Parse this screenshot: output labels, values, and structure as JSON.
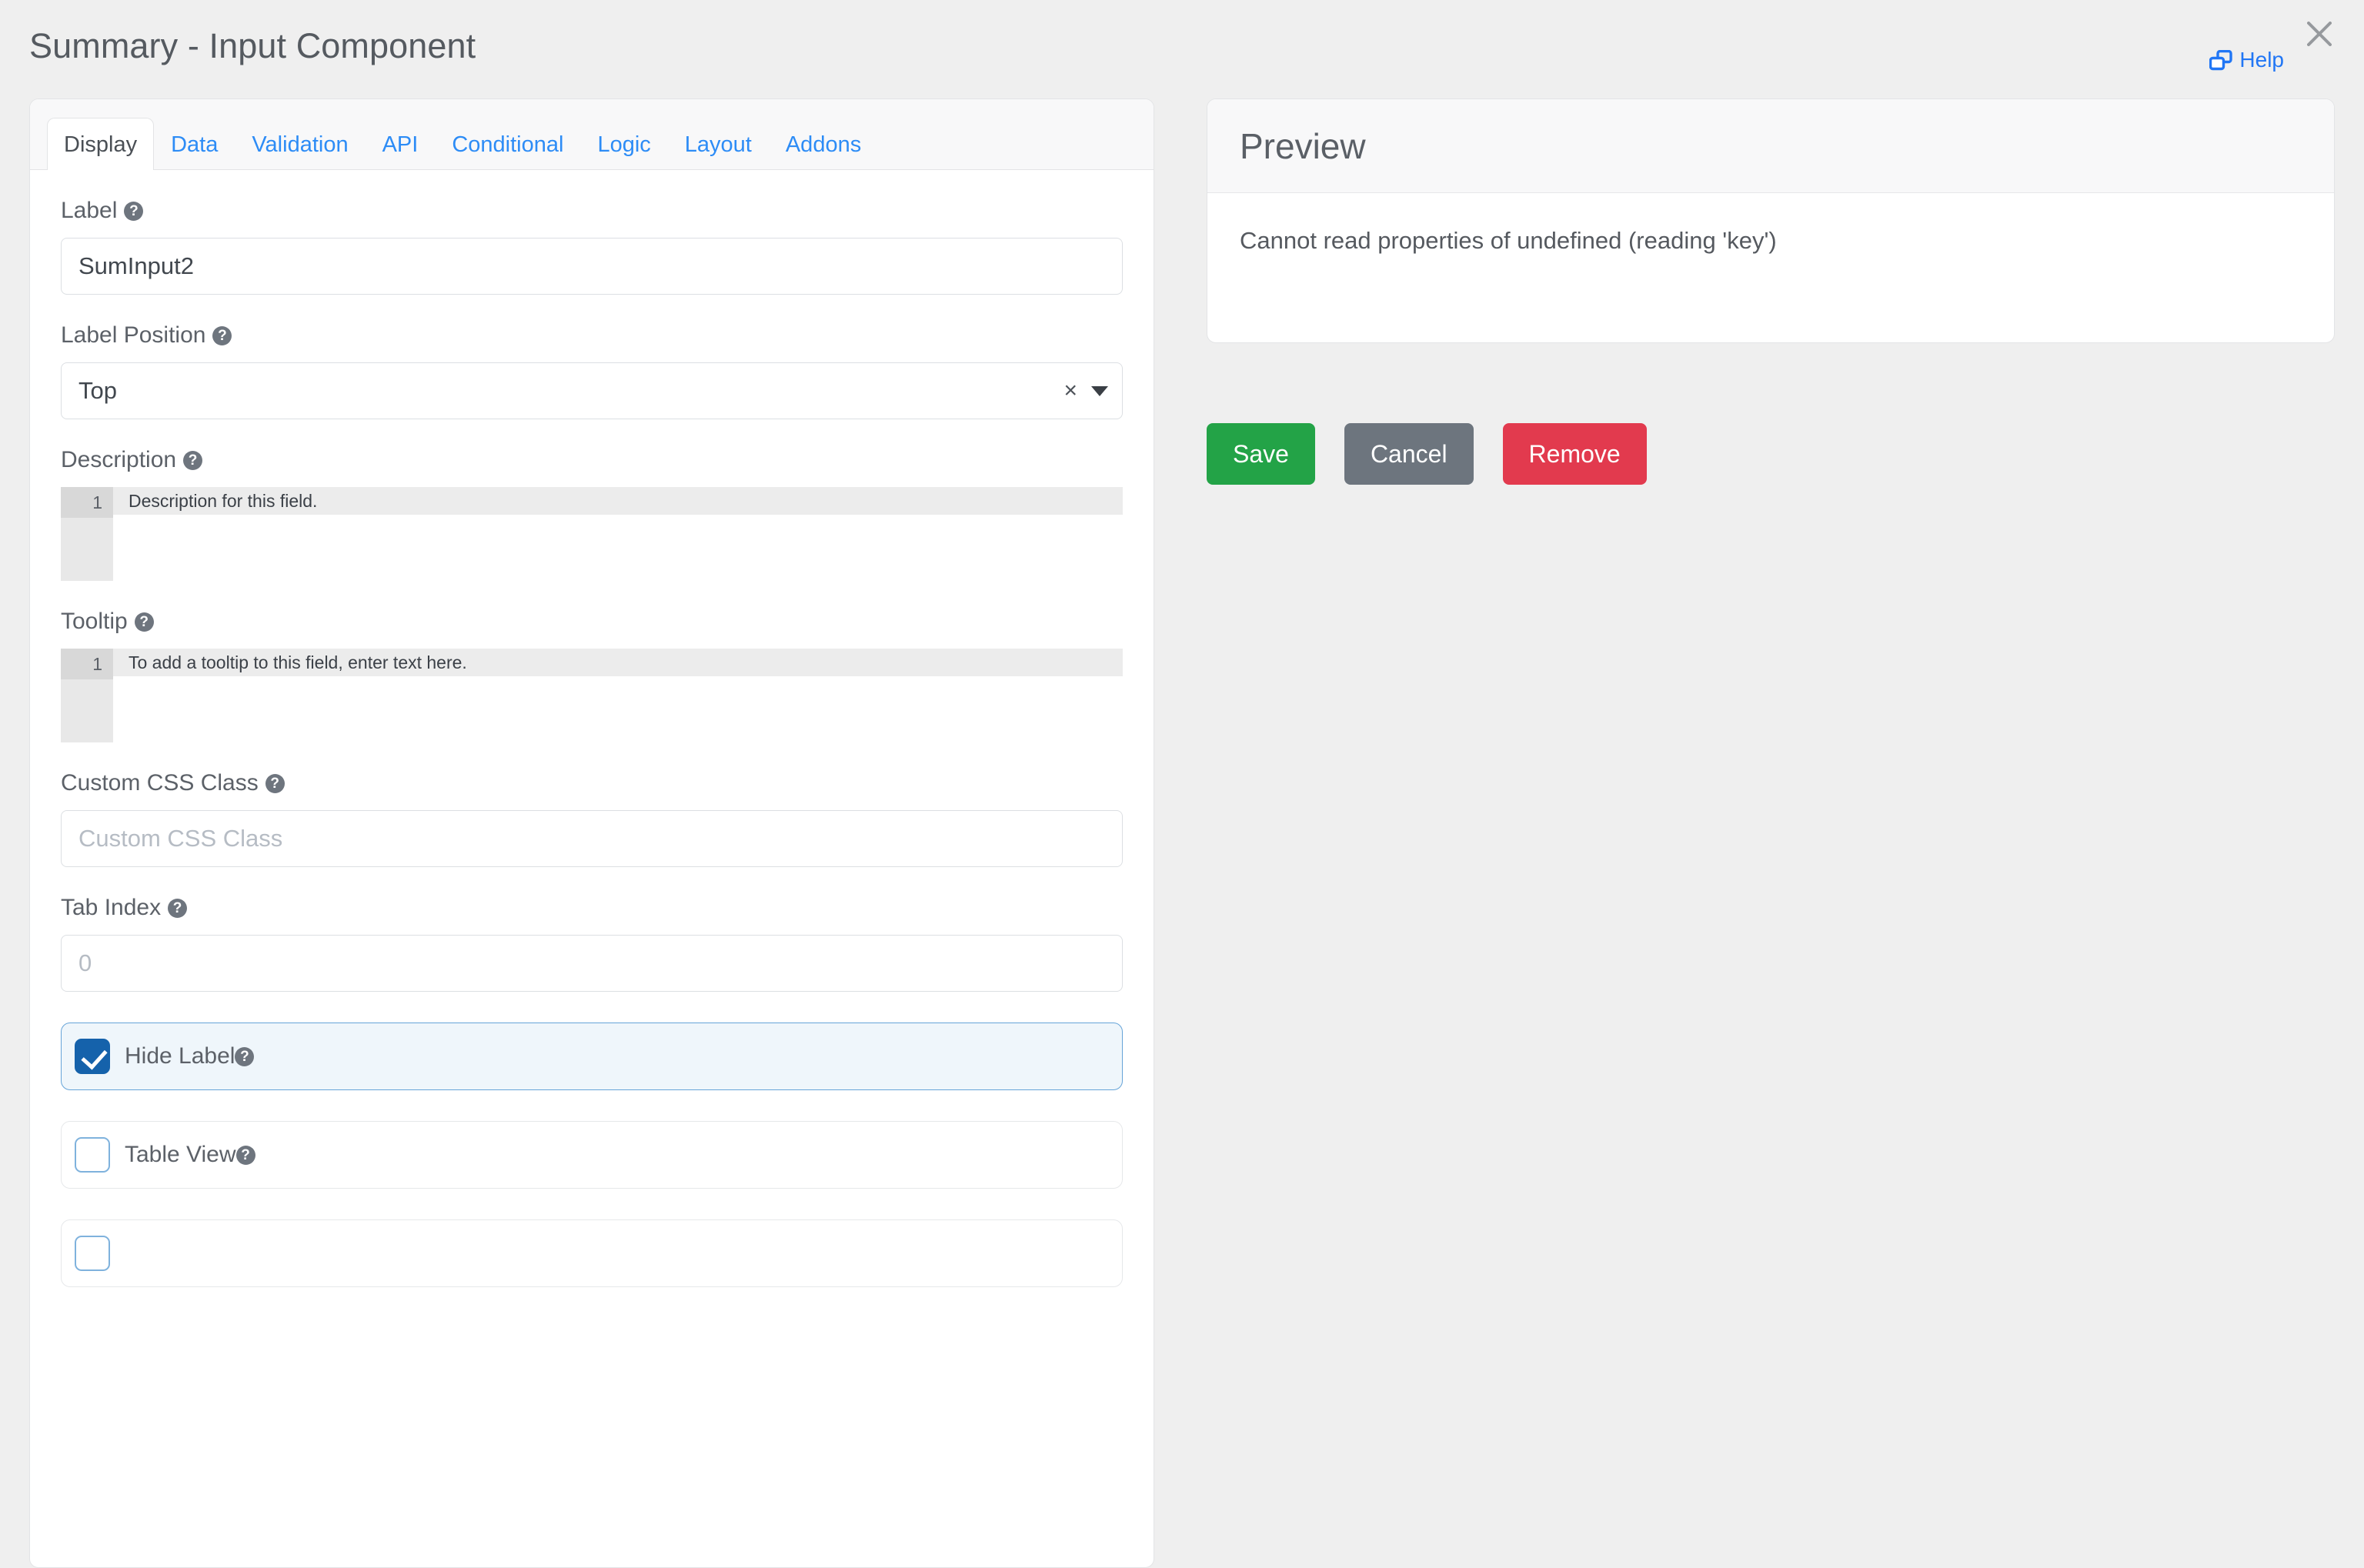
{
  "header": {
    "title": "Summary - Input Component",
    "help_label": "Help",
    "help_icon": "clone-window-icon",
    "close_icon": "close-icon"
  },
  "tabs": [
    {
      "label": "Display",
      "active": true
    },
    {
      "label": "Data",
      "active": false
    },
    {
      "label": "Validation",
      "active": false
    },
    {
      "label": "API",
      "active": false
    },
    {
      "label": "Conditional",
      "active": false
    },
    {
      "label": "Logic",
      "active": false
    },
    {
      "label": "Layout",
      "active": false
    },
    {
      "label": "Addons",
      "active": false
    }
  ],
  "form": {
    "label_field": {
      "label": "Label",
      "value": "SumInput2",
      "help_icon": "question-mark-icon"
    },
    "label_position": {
      "label": "Label Position",
      "value": "Top",
      "clear_icon": "×",
      "caret_icon": "chevron-down-icon",
      "help_icon": "question-mark-icon"
    },
    "description": {
      "label": "Description",
      "line_number": "1",
      "value": "Description for this field.",
      "help_icon": "question-mark-icon"
    },
    "tooltip": {
      "label": "Tooltip",
      "line_number": "1",
      "value": "To add a tooltip to this field, enter text here.",
      "help_icon": "question-mark-icon"
    },
    "custom_css_class": {
      "label": "Custom CSS Class",
      "value": "",
      "placeholder": "Custom CSS Class",
      "help_icon": "question-mark-icon"
    },
    "tab_index": {
      "label": "Tab Index",
      "value": "",
      "placeholder": "0",
      "help_icon": "question-mark-icon"
    },
    "checkboxes": [
      {
        "label": "Hide Label",
        "checked": true,
        "help_icon": "question-mark-icon"
      },
      {
        "label": "Table View",
        "checked": false,
        "help_icon": "question-mark-icon"
      }
    ]
  },
  "preview": {
    "title": "Preview",
    "message": "Cannot read properties of undefined (reading 'key')"
  },
  "actions": {
    "save_label": "Save",
    "cancel_label": "Cancel",
    "remove_label": "Remove"
  },
  "colors": {
    "accent_blue": "#2d8cf6",
    "save_green": "#23a347",
    "cancel_gray": "#6d757e",
    "remove_red": "#e23a4e",
    "checkbox_blue": "#1562ab",
    "page_background": "#efefef"
  }
}
